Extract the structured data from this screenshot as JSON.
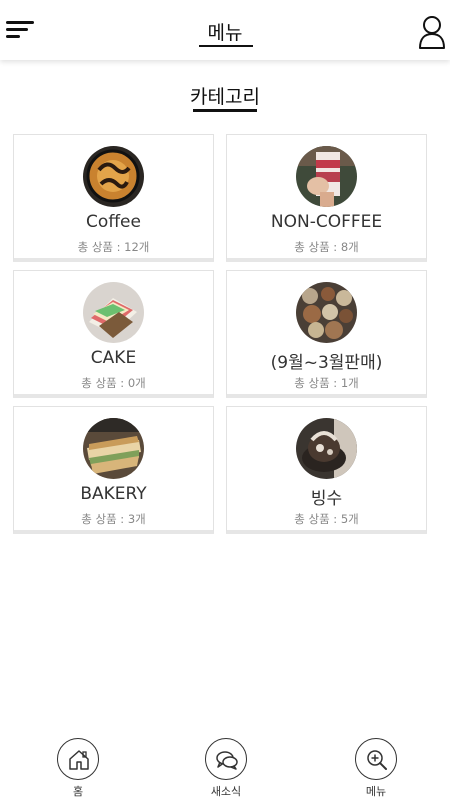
{
  "header": {
    "title": "메뉴",
    "menu_icon": "hamburger-menu-icon",
    "user_icon": "user-profile-icon"
  },
  "section": {
    "title": "카테고리"
  },
  "categories": [
    {
      "name": "Coffee",
      "count": "총 상품 : 12개",
      "thumb": "coffee-photo"
    },
    {
      "name": "NON-COFFEE",
      "count": "총 상품 : 8개",
      "thumb": "non-coffee-photo"
    },
    {
      "name": "CAKE",
      "count": "총 상품 : 0개",
      "thumb": "cake-photo"
    },
    {
      "name": "(9월~3월판매)",
      "count": "총 상품 : 1개",
      "thumb": "seasonal-photo"
    },
    {
      "name": "BAKERY",
      "count": "총 상품 : 3개",
      "thumb": "bakery-photo"
    },
    {
      "name": "빙수",
      "count": "총 상품 : 5개",
      "thumb": "bingsu-photo"
    }
  ],
  "bottom_nav": {
    "home": {
      "label": "홈",
      "icon": "home-icon"
    },
    "news": {
      "label": "새소식",
      "icon": "chat-bubble-icon"
    },
    "menu": {
      "label": "메뉴",
      "icon": "search-plus-icon"
    }
  },
  "colors": {
    "text": "#222222",
    "muted": "#888888",
    "border": "#e2e2e2"
  }
}
